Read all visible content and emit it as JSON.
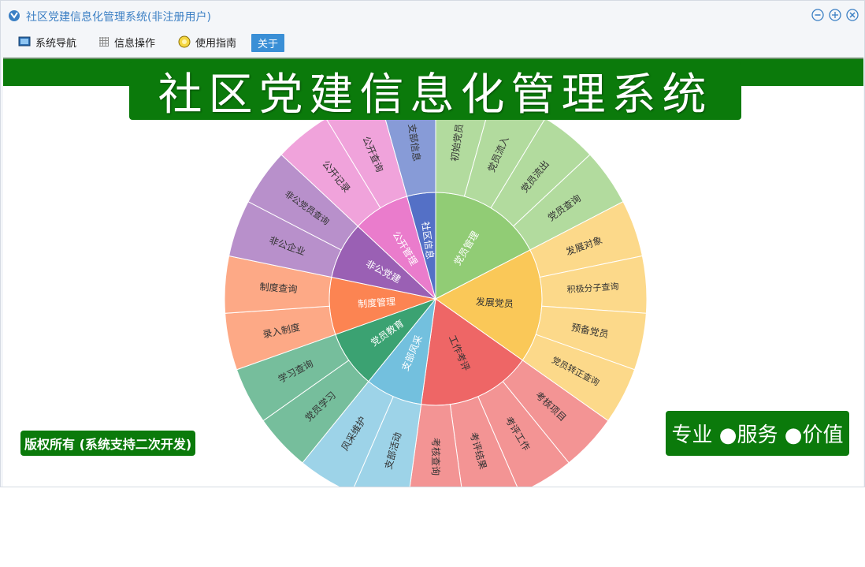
{
  "window": {
    "title": "社区党建信息化管理系统(非注册用户)"
  },
  "menu": {
    "nav": "系统导航",
    "info": "信息操作",
    "guide": "使用指南",
    "about": "关于"
  },
  "banner": {
    "title": "社区党建信息化管理系统"
  },
  "footer": {
    "copyright": "版权所有 (系统支持二次开发)",
    "slogan": "专业 ●服务 ●价值"
  },
  "chart_data": {
    "type": "sunburst",
    "categories": [
      {
        "name": "党员管理",
        "color": "#91cc75",
        "children": [
          "初始党员",
          "党员流入",
          "党员流出",
          "党员查询"
        ]
      },
      {
        "name": "发展党员",
        "color": "#fac858",
        "children": [
          "发展对象",
          "积极分子查询",
          "预备党员",
          "党员转正查询"
        ]
      },
      {
        "name": "工作考评",
        "color": "#ee6666",
        "children": [
          "考核项目",
          "考评工作",
          "考评结果",
          "考核查询"
        ]
      },
      {
        "name": "支部风采",
        "color": "#73c0de",
        "children": [
          "支部活动",
          "风采维护"
        ]
      },
      {
        "name": "党员教育",
        "color": "#3ba272",
        "children": [
          "党员学习",
          "学习查询"
        ]
      },
      {
        "name": "制度管理",
        "color": "#fc8452",
        "children": [
          "录入制度",
          "制度查询"
        ]
      },
      {
        "name": "非公党建",
        "color": "#9a60b4",
        "children": [
          "非公企业",
          "非公党员查询"
        ]
      },
      {
        "name": "公开管理",
        "color": "#ea7ccc",
        "children": [
          "公开记录",
          "公开查询"
        ]
      },
      {
        "name": "社区信息",
        "color": "#5470c6",
        "children": [
          "支部信息"
        ]
      }
    ]
  }
}
